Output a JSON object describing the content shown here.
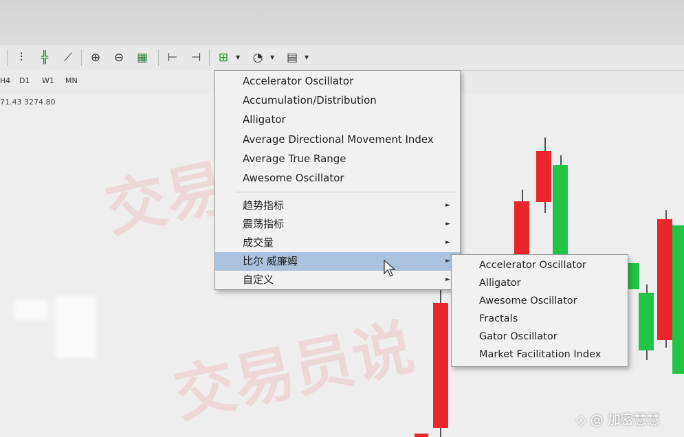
{
  "toolbar": {
    "buttons": [
      {
        "icon": "bar-chart-icon",
        "glyph": "⫶"
      },
      {
        "icon": "candlestick-chart-icon",
        "glyph": "╬"
      },
      {
        "icon": "line-chart-icon",
        "glyph": "⟋"
      },
      {
        "icon": "zoom-in-icon",
        "glyph": "⊕"
      },
      {
        "icon": "zoom-out-icon",
        "glyph": "⊖"
      },
      {
        "icon": "tile-windows-icon",
        "glyph": "▦"
      },
      {
        "icon": "chart-shift-icon",
        "glyph": "⊢"
      },
      {
        "icon": "autoscroll-icon",
        "glyph": "⊣"
      },
      {
        "icon": "indicators-icon",
        "glyph": "⊞"
      },
      {
        "icon": "periods-icon",
        "glyph": "◔"
      },
      {
        "icon": "templates-icon",
        "glyph": "▤"
      }
    ]
  },
  "timeframes": [
    "H4",
    "D1",
    "W1",
    "MN"
  ],
  "price_readout": "71.43 3274.80",
  "indicator_menu": {
    "items": [
      {
        "label": "Accelerator Oscillator",
        "submenu": false
      },
      {
        "label": "Accumulation/Distribution",
        "submenu": false
      },
      {
        "label": "Alligator",
        "submenu": false
      },
      {
        "label": "Average Directional Movement Index",
        "submenu": false
      },
      {
        "label": "Average True Range",
        "submenu": false
      },
      {
        "label": "Awesome Oscillator",
        "submenu": false
      }
    ],
    "groups": [
      {
        "label": "趋势指标",
        "submenu": true
      },
      {
        "label": "震荡指标",
        "submenu": true
      },
      {
        "label": "成交量",
        "submenu": true
      },
      {
        "label": "比尔 威廉姆",
        "submenu": true,
        "highlighted": true
      },
      {
        "label": "自定义",
        "submenu": true
      }
    ]
  },
  "bill_williams_submenu": {
    "items": [
      "Accelerator Oscillator",
      "Alligator",
      "Awesome Oscillator",
      "Fractals",
      "Gator Oscillator",
      "Market Facilitation Index"
    ]
  },
  "watermark": "交易员说",
  "credit": "◇ @ 加密慧慧",
  "colors": {
    "bull": "#22c445",
    "bear": "#e8262b",
    "highlight": "#a9c3df"
  }
}
